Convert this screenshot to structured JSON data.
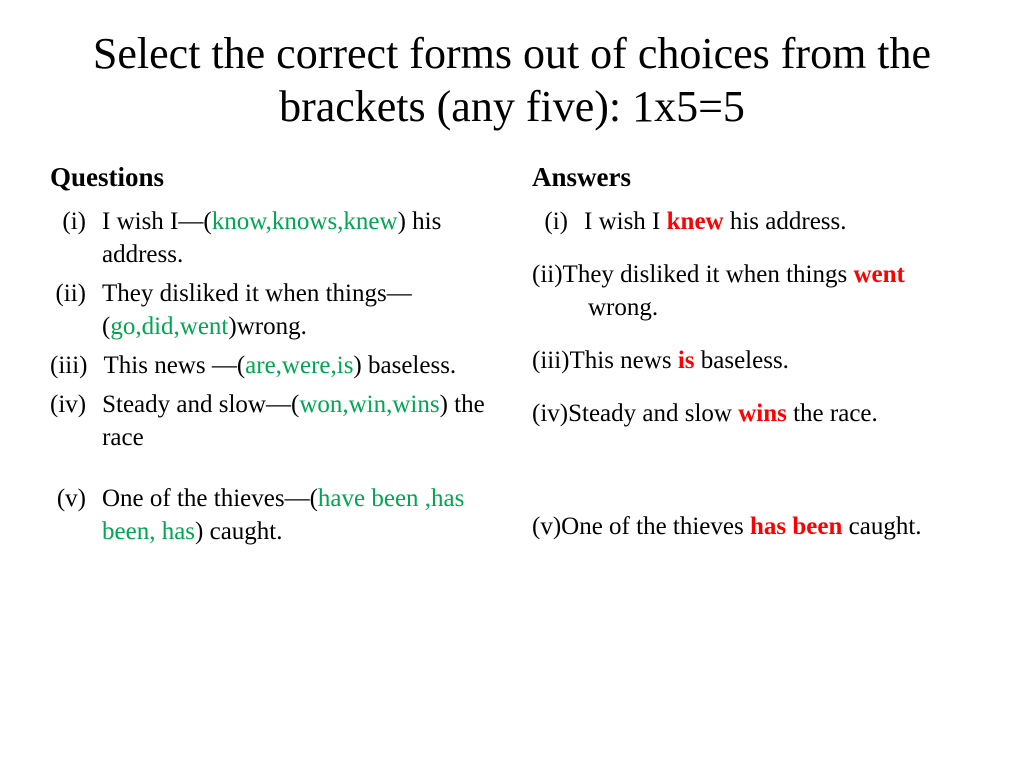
{
  "title": "Select the correct forms out of choices from the brackets (any five): 1x5=5",
  "questions_header": "Questions",
  "answers_header": "Answers",
  "q": {
    "m1": "(i)",
    "m2": "(ii)",
    "m3": "(iii)",
    "m4": "(iv)",
    "m5": "(v)",
    "q1a": "I wish I—(",
    "q1b": "know,knows,knew",
    "q1c": ") his address.",
    "q2a": "They disliked it when things—(",
    "q2b": "go,did,went",
    "q2c": ")wrong.",
    "q3a": "This news —(",
    "q3b": "are,were,is",
    "q3c": ") baseless.",
    "q4a": "Steady and slow—(",
    "q4b": "won,win,wins",
    "q4c": ") the race",
    "q5a": "One of the thieves—(",
    "q5b": "have been ,has been, has",
    "q5c": ") caught."
  },
  "a": {
    "m1": "(i)",
    "a1a": "I wish I ",
    "a1b": "knew",
    "a1c": " his address.",
    "a2a": "(ii)They disliked it when things ",
    "a2b": "went",
    "a2c": " wrong.",
    "a3a": "(iii)This news ",
    "a3b": "is",
    "a3c": " baseless.",
    "a4a": "(iv)Steady and slow ",
    "a4b": "wins",
    "a4c": " the race.",
    "a5a": "(v)One of the thieves ",
    "a5b": "has been",
    "a5c": " caught."
  }
}
